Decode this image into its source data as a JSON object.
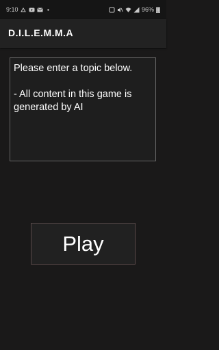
{
  "status_bar": {
    "time": "9:10",
    "left_icons": [
      "notification-icon",
      "youtube-icon",
      "mail-icon",
      "more-icon"
    ],
    "right_icons": [
      "nfc-icon",
      "mute-icon",
      "wifi-icon",
      "signal-icon"
    ],
    "battery": "96%"
  },
  "app_bar": {
    "title": "D.I.L.E.M.M.A"
  },
  "topic_input": {
    "placeholder": "Please enter a topic below.\n\n- All content in this game is generated by AI"
  },
  "play_button": {
    "label": "Play"
  },
  "colors": {
    "background": "#1a1919",
    "app_bar": "#222222",
    "input_border": "#666666",
    "button_border": "#5a4a4a",
    "text": "#ffffff"
  }
}
